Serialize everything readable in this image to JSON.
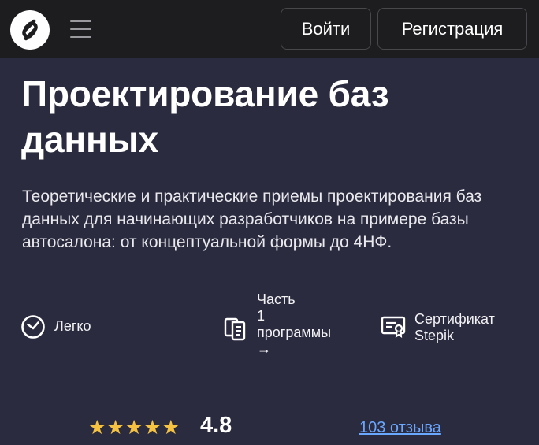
{
  "header": {
    "logo_icon": "stepik-logo-icon",
    "menu_icon": "hamburger-menu-icon",
    "login_label": "Войти",
    "register_label": "Регистрация"
  },
  "course": {
    "title": "Проектирование баз данных",
    "description": "Теоретические и практические приемы проектирования баз данных для начинающих разработчиков на примере базы автосалона: от концептуальной формы до 4НФ.",
    "features": {
      "level": {
        "icon": "clock-icon",
        "label": "Легко"
      },
      "program": {
        "icon": "documents-icon",
        "line1": "Часть",
        "line2": "1",
        "line3": "программы",
        "arrow": "→"
      },
      "certificate": {
        "icon": "certificate-icon",
        "line1": "Сертификат",
        "line2": "Stepik"
      }
    },
    "rating": {
      "stars": "★★★★★",
      "value": "4.8",
      "reviews_link": "103 отзыва"
    }
  },
  "colors": {
    "header_bg": "#1d1d1f",
    "main_bg": "#2b2b40",
    "star": "#f5c242",
    "link": "#6aa7ff"
  }
}
